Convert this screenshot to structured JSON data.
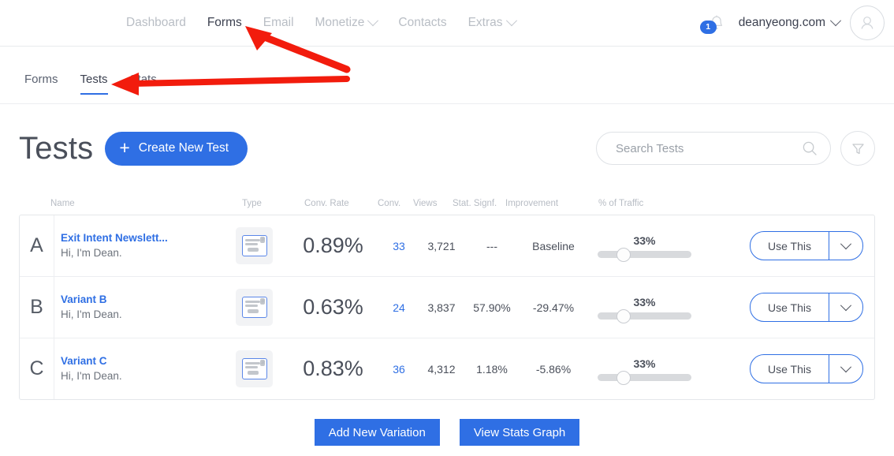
{
  "topnav": {
    "items": [
      {
        "label": "Dashboard",
        "active": false,
        "caret": false
      },
      {
        "label": "Forms",
        "active": true,
        "caret": false
      },
      {
        "label": "Email",
        "active": false,
        "caret": false
      },
      {
        "label": "Monetize",
        "active": false,
        "caret": true
      },
      {
        "label": "Contacts",
        "active": false,
        "caret": false
      },
      {
        "label": "Extras",
        "active": false,
        "caret": true
      }
    ],
    "notification_count": "1",
    "account_name": "deanyeong.com"
  },
  "subtabs": [
    {
      "label": "Forms",
      "active": false
    },
    {
      "label": "Tests",
      "active": true
    },
    {
      "label": "Stats",
      "active": false
    }
  ],
  "header": {
    "title": "Tests",
    "create_button": "Create New Test"
  },
  "search": {
    "placeholder": "Search Tests",
    "value": ""
  },
  "table": {
    "columns": [
      "Name",
      "Type",
      "Conv. Rate",
      "Conv.",
      "Views",
      "Stat. Signf.",
      "Improvement",
      "% of Traffic"
    ],
    "rows": [
      {
        "letter": "A",
        "name": "Exit Intent Newslett...",
        "subtitle": "Hi, I'm Dean.",
        "conv_rate": "0.89%",
        "conv": "33",
        "views": "3,721",
        "stat_signf": "---",
        "improvement": "Baseline",
        "traffic": "33%",
        "action_label": "Use This"
      },
      {
        "letter": "B",
        "name": "Variant B",
        "subtitle": "Hi, I'm Dean.",
        "conv_rate": "0.63%",
        "conv": "24",
        "views": "3,837",
        "stat_signf": "57.90%",
        "improvement": "-29.47%",
        "traffic": "33%",
        "action_label": "Use This"
      },
      {
        "letter": "C",
        "name": "Variant C",
        "subtitle": "Hi, I'm Dean.",
        "conv_rate": "0.83%",
        "conv": "36",
        "views": "4,312",
        "stat_signf": "1.18%",
        "improvement": "-5.86%",
        "traffic": "33%",
        "action_label": "Use This"
      }
    ]
  },
  "footer": {
    "add_variation": "Add New Variation",
    "view_stats": "View Stats Graph"
  },
  "colors": {
    "accent_blue": "#2f6fe4",
    "annotation_red": "#f21c0d",
    "muted_text": "#b9bec5"
  }
}
